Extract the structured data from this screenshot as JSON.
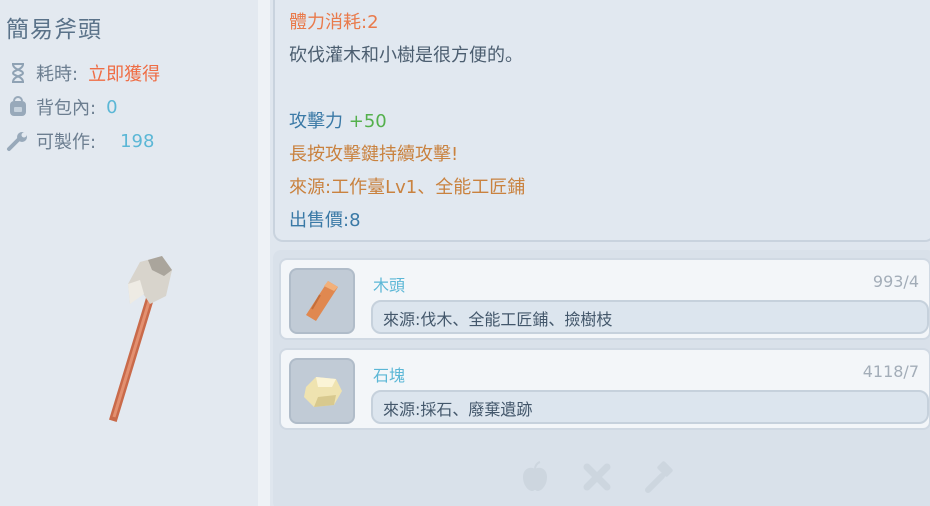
{
  "item": {
    "title": "簡易斧頭",
    "stats": [
      {
        "label": "耗時:",
        "value": "立即獲得",
        "icon": "hourglass-icon",
        "color": "#ef6d45"
      },
      {
        "label": "背包內:",
        "value": "0",
        "icon": "backpack-icon",
        "color": "#5bb7d6"
      },
      {
        "label": "可製作:",
        "value": "198",
        "icon": "wrench-icon",
        "color": "#5bb7d6"
      }
    ]
  },
  "desc": {
    "stamina_label": "體力消耗:",
    "stamina_value": "2",
    "text": "砍伐灌木和小樹是很方便的。",
    "attack_label": "攻擊力",
    "attack_value": "+50",
    "hold_text": "長按攻擊鍵持續攻擊!",
    "source_label": "來源:",
    "source_value": "工作臺Lv1、全能工匠鋪",
    "price_label": "出售價:",
    "price_value": "8"
  },
  "materials": [
    {
      "name": "木頭",
      "count": "993/4",
      "source": "來源:伐木、全能工匠鋪、撿樹枝",
      "icon": "wood-log-icon"
    },
    {
      "name": "石塊",
      "count": "4118/7",
      "source": "來源:採石、廢棄遺跡",
      "icon": "stone-icon"
    }
  ],
  "bottom_icons": [
    "apple-icon",
    "cross-icon",
    "hammer-icon"
  ]
}
